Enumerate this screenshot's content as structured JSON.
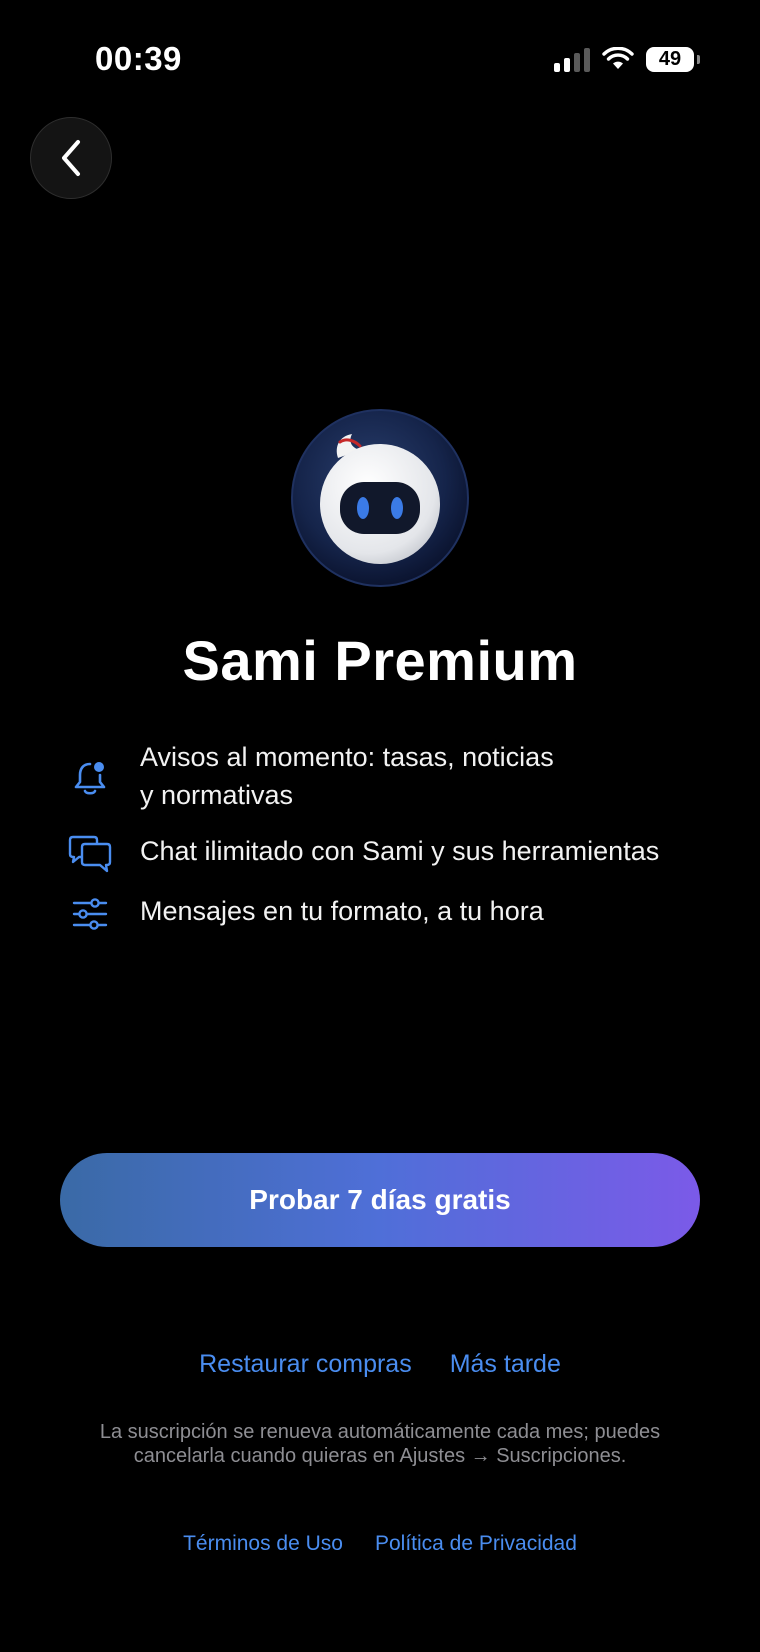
{
  "status_bar": {
    "time": "00:39",
    "battery": "49"
  },
  "header": {
    "back_icon": "chevron-left-icon"
  },
  "hero": {
    "title": "Sami Premium",
    "mascot_icon": "robot-mascot-icon"
  },
  "features": [
    {
      "icon": "bell-badge-icon",
      "text": "Avisos al momento: tasas, noticias\ny normativas"
    },
    {
      "icon": "chat-bubbles-icon",
      "text": "Chat ilimitado con Sami y sus herramientas"
    },
    {
      "icon": "sliders-icon",
      "text": "Mensajes en tu formato, a tu hora"
    }
  ],
  "cta": {
    "label": "Probar 7 días gratis"
  },
  "links": {
    "restore": "Restaurar compras",
    "later": "Más tarde"
  },
  "notice": "La suscripción se renueva automáticamente cada mes; puedes cancelarla cuando quieras en Ajustes → Suscripciones.",
  "legal": {
    "terms": "Términos de Uso",
    "privacy": "Política de Privacidad"
  },
  "colors": {
    "accent": "#4a8df0",
    "background": "#000000",
    "cta_gradient_start": "#3a6aa6",
    "cta_gradient_end": "#7b5ae8"
  }
}
